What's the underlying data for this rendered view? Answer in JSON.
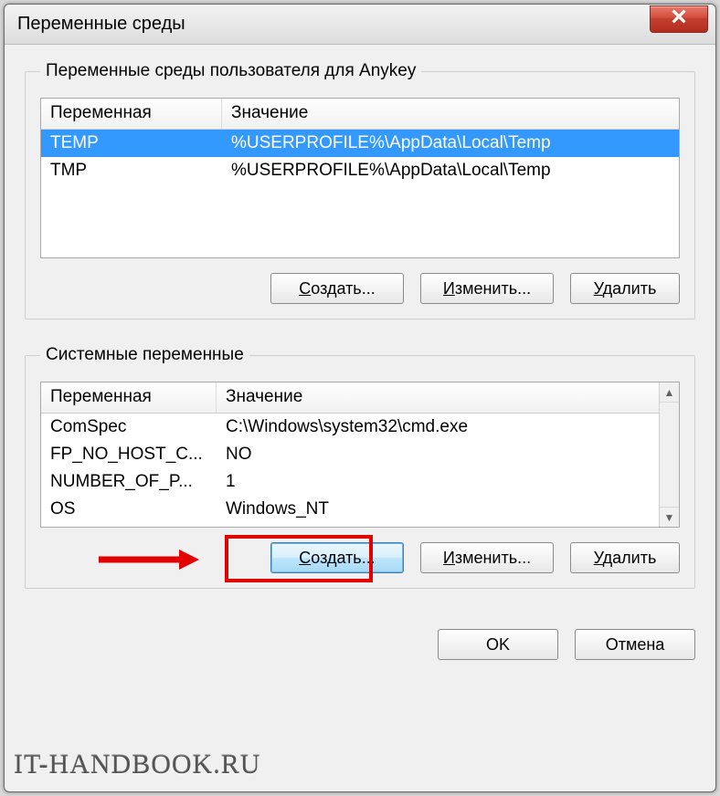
{
  "window": {
    "title": "Переменные среды"
  },
  "user_group": {
    "legend": "Переменные среды пользователя для Anykey",
    "col_variable": "Переменная",
    "col_value": "Значение",
    "rows": [
      {
        "name": "TEMP",
        "value": "%USERPROFILE%\\AppData\\Local\\Temp",
        "selected": true
      },
      {
        "name": "TMP",
        "value": "%USERPROFILE%\\AppData\\Local\\Temp",
        "selected": false
      }
    ],
    "btn_create": "Создать...",
    "btn_edit": "Изменить...",
    "btn_delete": "Удалить"
  },
  "sys_group": {
    "legend": "Системные переменные",
    "col_variable": "Переменная",
    "col_value": "Значение",
    "rows": [
      {
        "name": "ComSpec",
        "value": "C:\\Windows\\system32\\cmd.exe"
      },
      {
        "name": "FP_NO_HOST_C...",
        "value": "NO"
      },
      {
        "name": "NUMBER_OF_P...",
        "value": "1"
      },
      {
        "name": "OS",
        "value": "Windows_NT"
      }
    ],
    "btn_create": "Создать...",
    "btn_edit": "Изменить...",
    "btn_delete": "Удалить"
  },
  "footer": {
    "ok": "OK",
    "cancel": "Отмена"
  },
  "watermark": "IT-HANDBOOK.RU"
}
